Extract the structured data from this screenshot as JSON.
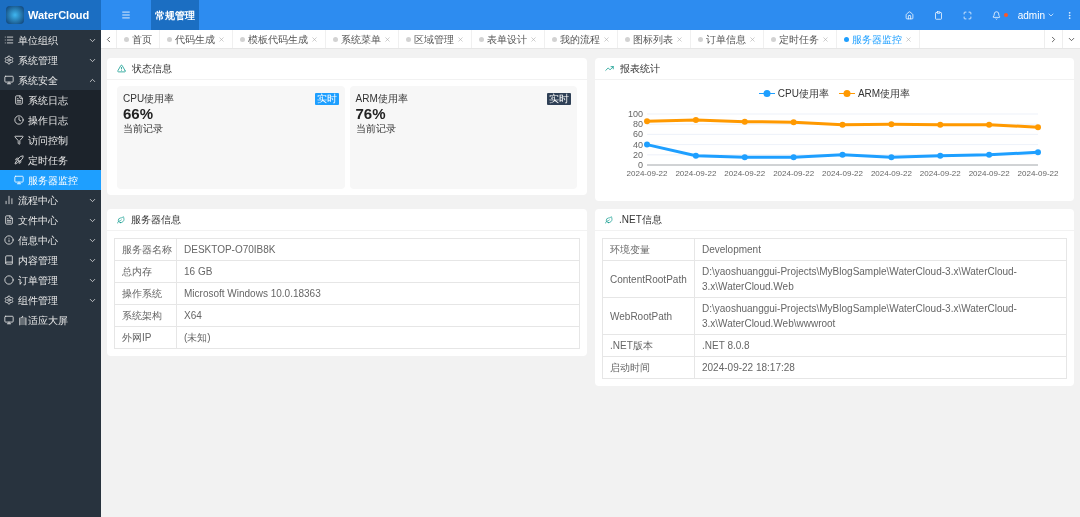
{
  "header": {
    "logo": "WaterCloud",
    "menu_title": "常规管理",
    "user": "admin",
    "notification_dot": true
  },
  "sidebar": {
    "items": [
      {
        "label": "单位组织",
        "expanded": false,
        "selected": false
      },
      {
        "label": "系统管理",
        "expanded": false,
        "selected": false
      },
      {
        "label": "系统安全",
        "expanded": true,
        "selected": false,
        "children": [
          {
            "label": "系统日志",
            "selected": false
          },
          {
            "label": "操作日志",
            "selected": false
          },
          {
            "label": "访问控制",
            "selected": false
          },
          {
            "label": "定时任务",
            "selected": false
          },
          {
            "label": "服务器监控",
            "selected": true
          }
        ]
      },
      {
        "label": "流程中心",
        "expanded": false,
        "selected": false
      },
      {
        "label": "文件中心",
        "expanded": false,
        "selected": false
      },
      {
        "label": "信息中心",
        "expanded": false,
        "selected": false
      },
      {
        "label": "内容管理",
        "expanded": false,
        "selected": false
      },
      {
        "label": "订单管理",
        "expanded": false,
        "selected": false
      },
      {
        "label": "组件管理",
        "expanded": false,
        "selected": false
      },
      {
        "label": "自适应大屏",
        "selected": false
      }
    ]
  },
  "tabs": [
    {
      "label": "首页",
      "selected": false,
      "closable": false
    },
    {
      "label": "代码生成",
      "selected": false,
      "closable": true
    },
    {
      "label": "模板代码生成",
      "selected": false,
      "closable": true
    },
    {
      "label": "系统菜单",
      "selected": false,
      "closable": true
    },
    {
      "label": "区域管理",
      "selected": false,
      "closable": true
    },
    {
      "label": "表单设计",
      "selected": false,
      "closable": true
    },
    {
      "label": "我的流程",
      "selected": false,
      "closable": true
    },
    {
      "label": "图标列表",
      "selected": false,
      "closable": true
    },
    {
      "label": "订单信息",
      "selected": false,
      "closable": true
    },
    {
      "label": "定时任务",
      "selected": false,
      "closable": true
    },
    {
      "label": "服务器监控",
      "selected": true,
      "closable": true
    }
  ],
  "status_panel": {
    "title": "状态信息",
    "cards": [
      {
        "label": "CPU使用率",
        "badge": "实时",
        "color": "#1e9fff",
        "value": "66%",
        "note": "当前记录"
      },
      {
        "label": "ARM使用率",
        "badge": "实时",
        "color": "#2f4056",
        "value": "76%",
        "note": "当前记录"
      }
    ]
  },
  "chart_panel": {
    "title": "报表统计",
    "chart_data": {
      "type": "line",
      "categories": [
        "2024-09-22",
        "2024-09-22",
        "2024-09-22",
        "2024-09-22",
        "2024-09-22",
        "2024-09-22",
        "2024-09-22",
        "2024-09-22",
        "2024-09-22"
      ],
      "series": [
        {
          "name": "CPU使用率",
          "color": "#1e9fff",
          "marker": "circle",
          "values": [
            40,
            18,
            15,
            15,
            20,
            15,
            18,
            20,
            25
          ]
        },
        {
          "name": "ARM使用率",
          "color": "#ff9900",
          "marker": "circle",
          "values": [
            86,
            88,
            85,
            84,
            79,
            80,
            79,
            79,
            74
          ]
        }
      ],
      "ylim": [
        0,
        100
      ],
      "yticks": [
        0,
        20,
        40,
        60,
        80,
        100
      ],
      "grid": true,
      "legend": true
    }
  },
  "server_panel": {
    "title": "服务器信息",
    "rows": [
      {
        "label": "服务器名称",
        "value": "DESKTOP-O70IB8K"
      },
      {
        "label": "总内存",
        "value": "16 GB"
      },
      {
        "label": "操作系统",
        "value": "Microsoft Windows 10.0.18363"
      },
      {
        "label": "系统架构",
        "value": "X64"
      },
      {
        "label": "外网IP",
        "value": "(未知)"
      }
    ]
  },
  "net_panel": {
    "title": ".NET信息",
    "rows": [
      {
        "label": "环境变量",
        "value": "Development"
      },
      {
        "label": "ContentRootPath",
        "value": "D:\\yaoshuanggui-Projects\\MyBlogSample\\WaterCloud-3.x\\WaterCloud-3.x\\WaterCloud.Web"
      },
      {
        "label": "WebRootPath",
        "value": "D:\\yaoshuanggui-Projects\\MyBlogSample\\WaterCloud-3.x\\WaterCloud-3.x\\WaterCloud.Web\\wwwroot"
      },
      {
        "label": ".NET版本",
        "value": ".NET 8.0.8"
      },
      {
        "label": "启动时间",
        "value": "2024-09-22 18:17:28"
      }
    ]
  }
}
